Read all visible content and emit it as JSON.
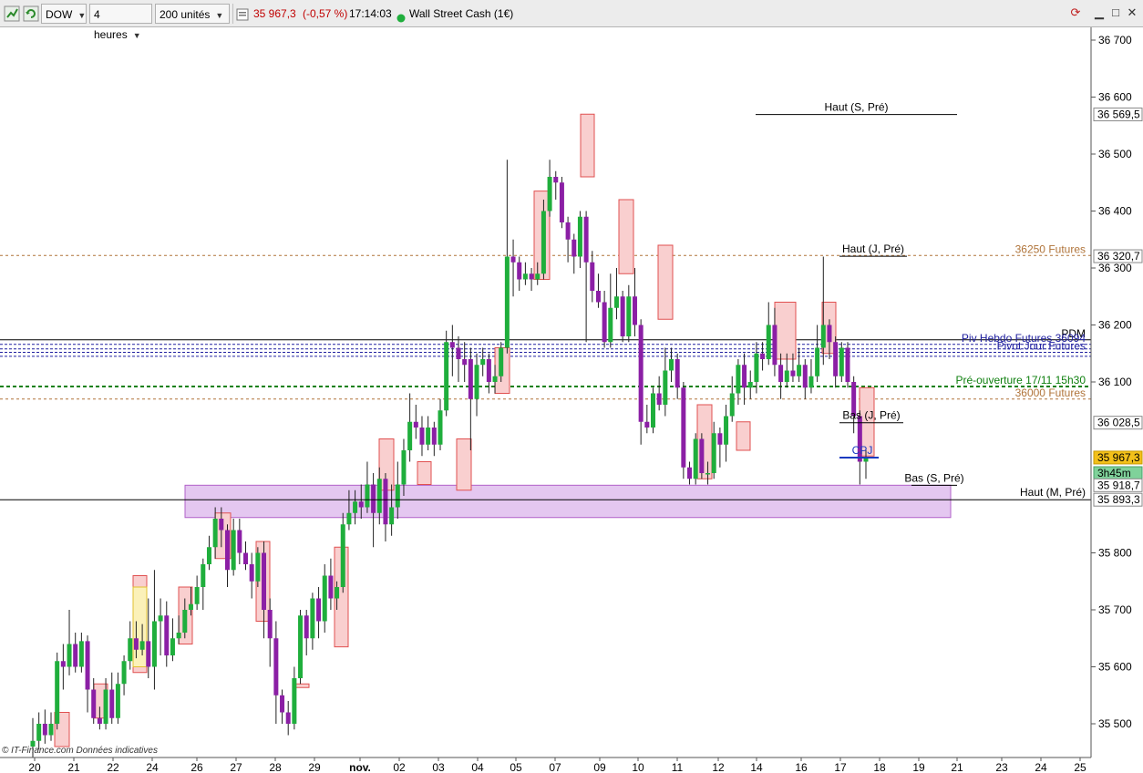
{
  "toolbar": {
    "symbol": "DOW",
    "timeframe": "4 heures",
    "units": "200 unités",
    "price": "35 967,3",
    "change": "(-0,57 %)",
    "time": "17:14:03",
    "instrument": "Wall Street Cash (1€)"
  },
  "colors": {
    "bull": "#1fae3c",
    "bear": "#8b1fa5",
    "futures": "#b0743a",
    "pivot": "#2020a0",
    "preopen": "#108010",
    "zone_fill": "#e4c7f0",
    "zone_border": "#b060c8",
    "box_fill": "#f9cfcf",
    "box_border": "#e05050"
  },
  "chart_data": {
    "type": "candlestick",
    "ylim": [
      35450,
      36730
    ],
    "y_ticks": [
      "36 700",
      "36 600",
      "36 500",
      "36 400",
      "36 300",
      "36 200",
      "36 100",
      "35 800",
      "35 700",
      "35 600",
      "35 500"
    ],
    "x_labels": [
      "20",
      "21",
      "22",
      "24",
      "26",
      "27",
      "28",
      "29",
      "nov.",
      "02",
      "03",
      "04",
      "05",
      "07",
      "09",
      "10",
      "11",
      "12",
      "14",
      "16",
      "17",
      "18",
      "19",
      "21",
      "23",
      "24",
      "25"
    ],
    "price_tags": [
      {
        "label": "36 569,5",
        "value": 36569.5,
        "kind": "plain"
      },
      {
        "label": "36 320,7",
        "value": 36320.7,
        "kind": "plain"
      },
      {
        "label": "36 028,5",
        "value": 36028.5,
        "kind": "plain"
      },
      {
        "label": "35 967,3",
        "value": 35967.3,
        "kind": "current"
      },
      {
        "label": "3h45m",
        "value": 35940,
        "kind": "timer"
      },
      {
        "label": "35 918,7",
        "value": 35918.7,
        "kind": "plain"
      },
      {
        "label": "35 893,3",
        "value": 35893.3,
        "kind": "plain"
      }
    ],
    "hlines": [
      {
        "label": "36250 Futures",
        "value": 36322,
        "style": "futures"
      },
      {
        "label": "PDM",
        "value": 36174,
        "style": "solid"
      },
      {
        "label": "Piv Hebdo Futures 36094",
        "value": 36166,
        "style": "pivot"
      },
      {
        "label": "Pivot Jour Futures",
        "value": 36152,
        "style": "pivot"
      },
      {
        "label": "Pré-ouverture 17/11 15h30",
        "value": 36092,
        "style": "preopen"
      },
      {
        "label": "36000 Futures",
        "value": 36070,
        "style": "futures"
      }
    ],
    "markers": [
      {
        "label": "Haut (S, Pré)",
        "value": 36569.5
      },
      {
        "label": "Haut (J, Pré)",
        "value": 36320.7
      },
      {
        "label": "Bas (J, Pré)",
        "value": 36028.5
      },
      {
        "label": "CPJ",
        "value": 35967.3
      },
      {
        "label": "Bas (S, Pré)",
        "value": 35918.7
      },
      {
        "label": "Haut (M, Pré)",
        "value": 35893.3
      }
    ],
    "zone": {
      "top": 35918.7,
      "bottom": 35862
    },
    "candles": [
      [
        35460,
        35470,
        35440,
        35510
      ],
      [
        35470,
        35500,
        35455,
        35520
      ],
      [
        35500,
        35480,
        35465,
        35525
      ],
      [
        35480,
        35500,
        35470,
        35520
      ],
      [
        35500,
        35610,
        35490,
        35625
      ],
      [
        35610,
        35600,
        35560,
        35640
      ],
      [
        35600,
        35640,
        35585,
        35700
      ],
      [
        35640,
        35600,
        35590,
        35660
      ],
      [
        35600,
        35645,
        35590,
        35660
      ],
      [
        35645,
        35560,
        35520,
        35655
      ],
      [
        35560,
        35510,
        35500,
        35580
      ],
      [
        35510,
        35500,
        35490,
        35530
      ],
      [
        35500,
        35560,
        35490,
        35580
      ],
      [
        35560,
        35510,
        35500,
        35590
      ],
      [
        35510,
        35570,
        35500,
        35590
      ],
      [
        35570,
        35610,
        35550,
        35620
      ],
      [
        35610,
        35650,
        35595,
        35680
      ],
      [
        35650,
        35630,
        35615,
        35680
      ],
      [
        35630,
        35645,
        35620,
        35675
      ],
      [
        35645,
        35600,
        35580,
        35720
      ],
      [
        35600,
        35680,
        35560,
        35770
      ],
      [
        35680,
        35690,
        35620,
        35720
      ],
      [
        35690,
        35620,
        35600,
        35715
      ],
      [
        35620,
        35650,
        35610,
        35685
      ],
      [
        35650,
        35660,
        35640,
        35690
      ],
      [
        35660,
        35700,
        35650,
        35720
      ],
      [
        35700,
        35710,
        35690,
        35740
      ],
      [
        35710,
        35740,
        35700,
        35760
      ],
      [
        35740,
        35780,
        35700,
        35790
      ],
      [
        35780,
        35810,
        35770,
        35830
      ],
      [
        35810,
        35860,
        35790,
        35880
      ],
      [
        35860,
        35840,
        35810,
        35880
      ],
      [
        35840,
        35770,
        35740,
        35850
      ],
      [
        35770,
        35840,
        35760,
        35860
      ],
      [
        35840,
        35800,
        35780,
        35860
      ],
      [
        35800,
        35780,
        35770,
        35820
      ],
      [
        35780,
        35750,
        35720,
        35800
      ],
      [
        35750,
        35800,
        35740,
        35810
      ],
      [
        35800,
        35700,
        35650,
        35820
      ],
      [
        35700,
        35650,
        35600,
        35720
      ],
      [
        35650,
        35550,
        35500,
        35680
      ],
      [
        35550,
        35520,
        35500,
        35560
      ],
      [
        35520,
        35500,
        35480,
        35540
      ],
      [
        35500,
        35580,
        35490,
        35600
      ],
      [
        35580,
        35690,
        35570,
        35700
      ],
      [
        35690,
        35650,
        35620,
        35700
      ],
      [
        35650,
        35720,
        35630,
        35730
      ],
      [
        35720,
        35680,
        35650,
        35740
      ],
      [
        35680,
        35760,
        35660,
        35780
      ],
      [
        35760,
        35720,
        35700,
        35790
      ],
      [
        35720,
        35740,
        35700,
        35750
      ],
      [
        35740,
        35850,
        35730,
        35870
      ],
      [
        35850,
        35870,
        35840,
        35910
      ],
      [
        35870,
        35890,
        35850,
        35910
      ],
      [
        35890,
        35880,
        35860,
        35920
      ],
      [
        35880,
        35920,
        35870,
        35960
      ],
      [
        35920,
        35870,
        35810,
        35940
      ],
      [
        35870,
        35930,
        35850,
        35950
      ],
      [
        35930,
        35850,
        35820,
        35940
      ],
      [
        35850,
        35880,
        35830,
        35920
      ],
      [
        35880,
        35920,
        35860,
        35960
      ],
      [
        35920,
        35980,
        35900,
        36000
      ],
      [
        35980,
        36030,
        35960,
        36080
      ],
      [
        36030,
        36020,
        36000,
        36060
      ],
      [
        36020,
        35990,
        35970,
        36040
      ],
      [
        35990,
        36020,
        35980,
        36040
      ],
      [
        36020,
        35990,
        35970,
        36030
      ],
      [
        35990,
        36050,
        35980,
        36070
      ],
      [
        36050,
        36170,
        36040,
        36190
      ],
      [
        36170,
        36160,
        36110,
        36200
      ],
      [
        36160,
        36140,
        36100,
        36180
      ],
      [
        36140,
        36130,
        36100,
        36170
      ],
      [
        36140,
        36070,
        35980,
        36160
      ],
      [
        36070,
        36130,
        36040,
        36150
      ],
      [
        36130,
        36140,
        36110,
        36160
      ],
      [
        36140,
        36100,
        36080,
        36150
      ],
      [
        36100,
        36110,
        36080,
        36130
      ],
      [
        36110,
        36160,
        36100,
        36170
      ],
      [
        36160,
        36320,
        36150,
        36490
      ],
      [
        36320,
        36310,
        36250,
        36350
      ],
      [
        36310,
        36280,
        36260,
        36320
      ],
      [
        36280,
        36290,
        36270,
        36310
      ],
      [
        36290,
        36280,
        36260,
        36300
      ],
      [
        36280,
        36290,
        36270,
        36310
      ],
      [
        36290,
        36400,
        36280,
        36420
      ],
      [
        36400,
        36460,
        36390,
        36490
      ],
      [
        36460,
        36450,
        36420,
        36470
      ],
      [
        36450,
        36380,
        36370,
        36460
      ],
      [
        36380,
        36350,
        36310,
        36390
      ],
      [
        36350,
        36320,
        36290,
        36360
      ],
      [
        36320,
        36390,
        36300,
        36400
      ],
      [
        36390,
        36310,
        36170,
        36400
      ],
      [
        36310,
        36260,
        36240,
        36330
      ],
      [
        36260,
        36240,
        36230,
        36290
      ],
      [
        36240,
        36170,
        36160,
        36260
      ],
      [
        36170,
        36230,
        36160,
        36290
      ],
      [
        36230,
        36250,
        36210,
        36300
      ],
      [
        36250,
        36180,
        36170,
        36260
      ],
      [
        36180,
        36250,
        36170,
        36270
      ],
      [
        36250,
        36200,
        36180,
        36300
      ],
      [
        36200,
        36030,
        35990,
        36210
      ],
      [
        36030,
        36020,
        36010,
        36060
      ],
      [
        36020,
        36080,
        36010,
        36090
      ],
      [
        36080,
        36060,
        36050,
        36110
      ],
      [
        36060,
        36120,
        36040,
        36160
      ],
      [
        36120,
        36140,
        36100,
        36160
      ],
      [
        36140,
        36090,
        36070,
        36150
      ],
      [
        36090,
        35950,
        35930,
        36100
      ],
      [
        35950,
        35930,
        35920,
        35960
      ],
      [
        35930,
        36000,
        35920,
        36010
      ],
      [
        36000,
        35940,
        35930,
        36010
      ],
      [
        35940,
        35940,
        35920,
        35960
      ],
      [
        35940,
        36010,
        35930,
        36030
      ],
      [
        36010,
        35990,
        35950,
        36020
      ],
      [
        35990,
        36040,
        35960,
        36060
      ],
      [
        36040,
        36080,
        36030,
        36110
      ],
      [
        36080,
        36130,
        36060,
        36140
      ],
      [
        36130,
        36090,
        36060,
        36150
      ],
      [
        36090,
        36100,
        36070,
        36120
      ],
      [
        36100,
        36150,
        36080,
        36170
      ],
      [
        36150,
        36140,
        36120,
        36170
      ],
      [
        36140,
        36200,
        36130,
        36240
      ],
      [
        36200,
        36130,
        36110,
        36230
      ],
      [
        36130,
        36100,
        36070,
        36150
      ],
      [
        36100,
        36120,
        36090,
        36150
      ],
      [
        36120,
        36110,
        36100,
        36150
      ],
      [
        36110,
        36130,
        36100,
        36160
      ],
      [
        36130,
        36090,
        36070,
        36140
      ],
      [
        36090,
        36110,
        36080,
        36140
      ],
      [
        36110,
        36160,
        36100,
        36200
      ],
      [
        36160,
        36200,
        36130,
        36320
      ],
      [
        36200,
        36170,
        36140,
        36210
      ],
      [
        36170,
        36110,
        36090,
        36180
      ],
      [
        36110,
        36160,
        36100,
        36170
      ],
      [
        36160,
        36100,
        36090,
        36170
      ],
      [
        36100,
        36040,
        36010,
        36110
      ],
      [
        36040,
        35960,
        35920,
        36050
      ],
      [
        35960,
        35967,
        35930,
        35980
      ]
    ]
  }
}
